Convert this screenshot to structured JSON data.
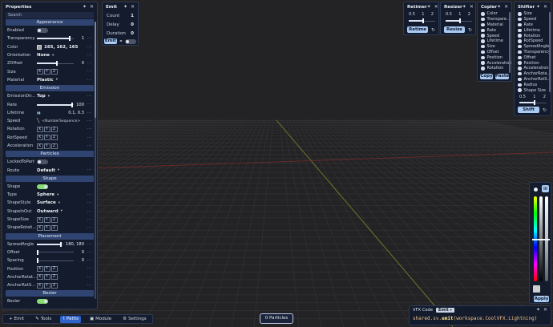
{
  "properties": {
    "title": "Properties",
    "search_placeholder": "Search",
    "sections": [
      {
        "title": "Appearance",
        "rows": [
          {
            "label": "Enabled",
            "kind": "toggle",
            "on": false
          },
          {
            "label": "Transparency",
            "kind": "slider",
            "level": 0.9,
            "value": "1"
          },
          {
            "label": "Color",
            "kind": "color",
            "swatch": "#a5a2a5",
            "value": "165, 162, 165"
          },
          {
            "label": "Orientation",
            "kind": "select",
            "value": "None"
          },
          {
            "label": "ZOffset",
            "kind": "slider",
            "level": 0.55,
            "value": "0"
          },
          {
            "label": "Size",
            "kind": "vector",
            "axes": [
              "X",
              "Y",
              "Z"
            ]
          },
          {
            "label": "Material",
            "kind": "select",
            "value": "Plastic"
          }
        ]
      },
      {
        "title": "Emission",
        "rows": [
          {
            "label": "EmissionDir...",
            "kind": "select",
            "value": "Top"
          },
          {
            "label": "Rate",
            "kind": "slider",
            "level": 0.96,
            "value": "100"
          },
          {
            "label": "Lifetime",
            "kind": "range",
            "value": "0.1, 0.3"
          },
          {
            "label": "Speed",
            "kind": "text",
            "value": "<NumberSequence>"
          },
          {
            "label": "Rotation",
            "kind": "vector",
            "axes": [
              "X",
              "Y",
              "Z"
            ]
          },
          {
            "label": "RotSpeed",
            "kind": "vector",
            "axes": [
              "X",
              "Y",
              "Z"
            ]
          },
          {
            "label": "Acceleration",
            "kind": "vector",
            "axes": [
              "X",
              "Y",
              "Z"
            ]
          }
        ]
      },
      {
        "title": "Particles",
        "rows": [
          {
            "label": "LockedToPart",
            "kind": "toggle",
            "on": false
          },
          {
            "label": "Route",
            "kind": "select",
            "value": "Default"
          }
        ]
      },
      {
        "title": "Shape",
        "rows": [
          {
            "label": "Shape",
            "kind": "toggle",
            "on": true
          },
          {
            "label": "Type",
            "kind": "select",
            "value": "Sphere"
          },
          {
            "label": "ShapeStyle",
            "kind": "select",
            "value": "Surface"
          },
          {
            "label": "ShapeInOut",
            "kind": "select",
            "value": "Outward"
          },
          {
            "label": "ShapeSize",
            "kind": "vector",
            "axes": [
              "X",
              "Y",
              "Z"
            ]
          },
          {
            "label": "ShapeRotati...",
            "kind": "vector",
            "axes": [
              "X",
              "Y",
              "Z"
            ]
          }
        ]
      },
      {
        "title": "Placement",
        "rows": [
          {
            "label": "SpreadAngle",
            "kind": "slider",
            "level": 0.92,
            "value": "180, 180"
          },
          {
            "label": "Offset",
            "kind": "slider",
            "level": 0.02,
            "value": "0"
          },
          {
            "label": "Spacing",
            "kind": "slider",
            "level": 0.02,
            "value": "0"
          },
          {
            "label": "Position",
            "kind": "vector",
            "axes": [
              "X",
              "Y",
              "Z"
            ]
          },
          {
            "label": "AnchorRotat...",
            "kind": "vector",
            "axes": [
              "X",
              "Y",
              "Z"
            ]
          },
          {
            "label": "AnchorRotS...",
            "kind": "vector",
            "axes": [
              "X",
              "Y",
              "Z"
            ]
          }
        ]
      },
      {
        "title": "Bezier",
        "rows": [
          {
            "label": "Bezier",
            "kind": "toggle",
            "on": true
          }
        ]
      }
    ]
  },
  "emit": {
    "title": "Emit",
    "rows": [
      {
        "label": "Count",
        "value": "1"
      },
      {
        "label": "Delay",
        "value": "0"
      },
      {
        "label": "Duration",
        "value": "0"
      }
    ],
    "button": "Emit"
  },
  "retimer": {
    "title": "Retimer",
    "ticks": [
      "0.5",
      "1",
      "2"
    ],
    "button": "Retime"
  },
  "resizer": {
    "title": "Resizer",
    "ticks": [
      "0.5",
      "1",
      "2"
    ],
    "button": "Resize"
  },
  "copier": {
    "title": "Copier",
    "items": [
      "Color",
      "Transpare...",
      "Material",
      "Rate",
      "Speed",
      "Lifetime",
      "Size",
      "Offset",
      "Position",
      "Acceleration",
      "Rotation"
    ],
    "copy": "Copy",
    "paste": "Paste"
  },
  "shifter": {
    "title": "Shifter",
    "items": [
      "Size",
      "Speed",
      "Rate",
      "Lifetime",
      "Rotation",
      "RotSpeed",
      "SpreadAngle",
      "Transparency",
      "Offset",
      "Position",
      "Acceleration",
      "AnchorRota...",
      "AnchorRotS...",
      "Radius",
      "Shape Size"
    ],
    "ticks": [
      "0.5",
      "1",
      "2"
    ],
    "button": "Shift"
  },
  "color_picker": {
    "button": "Apply"
  },
  "code": {
    "title": "VFX Code",
    "badge": "Emit",
    "prefix": "shared.sv.",
    "fn": "emit",
    "args": "(workspace.CoolVFX.Lightning)"
  },
  "toolbar": [
    {
      "label": "Emit",
      "icon": "plus-icon",
      "active": false
    },
    {
      "label": "Tools",
      "icon": "wrench-icon",
      "active": false
    },
    {
      "label": "Paths",
      "icon": "path-icon",
      "active": true
    },
    {
      "label": "Module",
      "icon": "module-icon",
      "active": false
    },
    {
      "label": "Settings",
      "icon": "gear-icon",
      "active": false
    }
  ],
  "particle_count": "0 Particles",
  "colors": {
    "accent": "#a9cbf4",
    "panel": "#131b2c",
    "section": "#2f4470",
    "toggle_on": "#89db74",
    "background": "#232325"
  }
}
